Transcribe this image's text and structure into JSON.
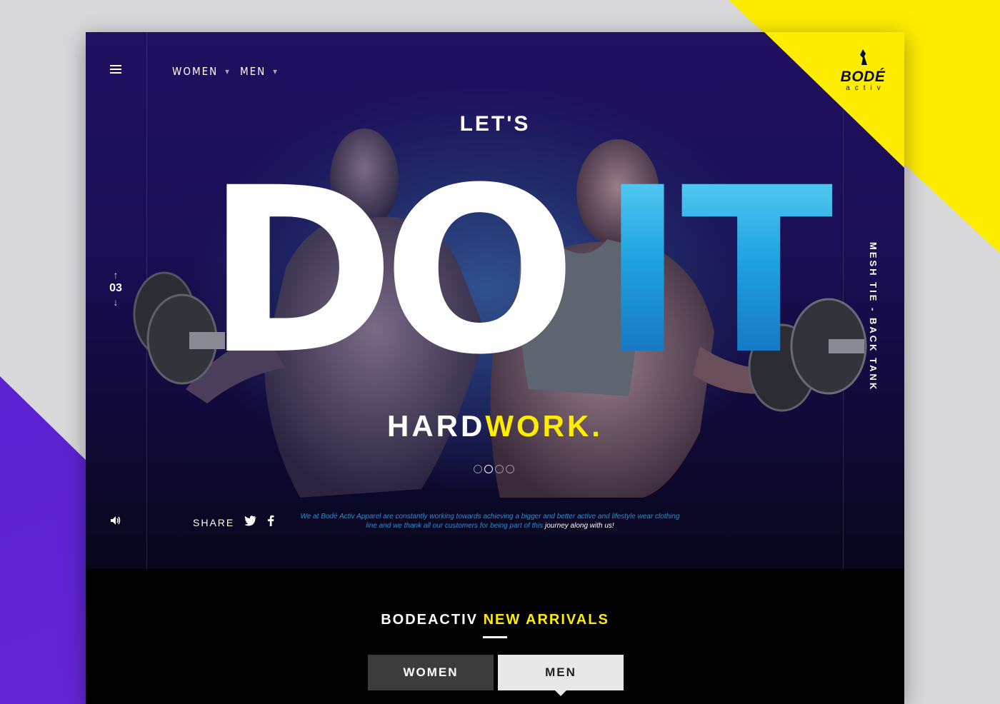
{
  "nav": {
    "items": [
      {
        "label": "WOMEN"
      },
      {
        "label": "MEN"
      }
    ]
  },
  "logo": {
    "word": "BODÉ",
    "sub": "activ"
  },
  "hero": {
    "lets": "LET'S",
    "big_left": "DO",
    "big_right": "IT",
    "hard": "HARD",
    "work": "WORK.",
    "slide_number": "03",
    "side_label": "MESH TIE - BACK TANK",
    "slides": 4,
    "active_slide": 2
  },
  "share": {
    "label": "SHARE"
  },
  "tagline": {
    "part1": "We at Bodé Activ Apparel are constantly working towards achieving a bigger and better active and lifestyle wear clothing line and we thank all our customers for being part of this ",
    "part2": "journey along with us!"
  },
  "arrivals": {
    "brand": "BODEACTIV",
    "title": "NEW ARRIVALS",
    "tabs": [
      {
        "label": "WOMEN"
      },
      {
        "label": "MEN"
      }
    ]
  },
  "colors": {
    "accent_yellow": "#ffed00",
    "accent_purple": "#5a22d2",
    "accent_blue": "#1fa2e0",
    "hero_bg": "#1a0e55"
  },
  "icons": [
    "menu-icon",
    "caret-down-icon",
    "arrow-up-icon",
    "arrow-down-icon",
    "volume-icon",
    "twitter-icon",
    "facebook-icon",
    "logo-figure-icon"
  ]
}
